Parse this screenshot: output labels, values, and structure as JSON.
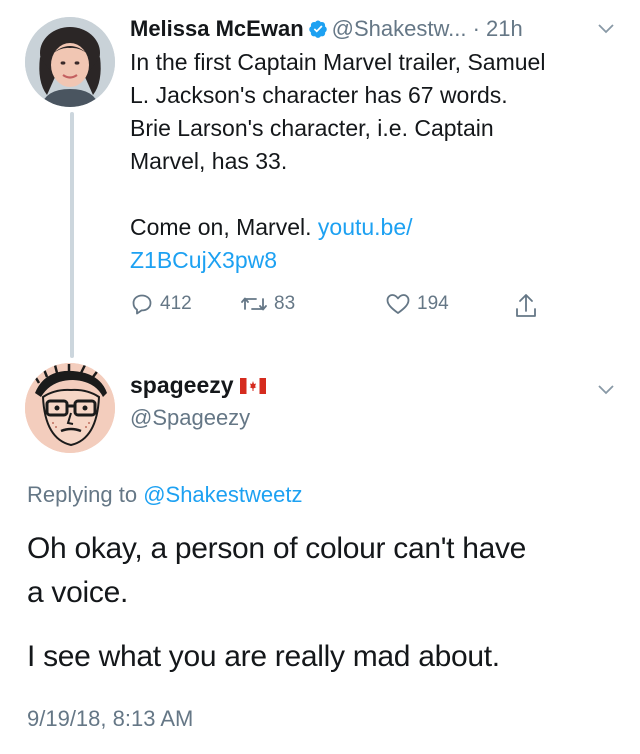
{
  "colors": {
    "link": "#1da1f2",
    "muted": "#657786",
    "text": "#14171a",
    "thread_line": "#ccd6dd"
  },
  "tweet1": {
    "author_name": "Melissa McEwan",
    "verified": true,
    "handle": "@Shakestw...",
    "separator": " · ",
    "time": "21h",
    "body_lines": [
      "In the first Captain Marvel trailer, Samuel",
      "L. Jackson's character has 67 words.",
      "Brie Larson's character, i.e. Captain",
      "Marvel, has 33."
    ],
    "body_line5_text": "Come on, Marvel. ",
    "link_line1": "youtu.be/",
    "link_line2": "Z1BCujX3pw8",
    "actions": {
      "reply_icon": "reply-icon",
      "replies": "412",
      "retweet_icon": "retweet-icon",
      "retweets": "83",
      "like_icon": "heart-icon",
      "likes": "194",
      "share_icon": "share-icon"
    }
  },
  "tweet2": {
    "author_name": "spageezy",
    "flag_icon": "canada-flag-icon",
    "handle": "@Spageezy",
    "replying_label": "Replying to ",
    "replying_handle": "@Shakestweetz",
    "body_para1_line1": "Oh okay, a person of colour can't have",
    "body_para1_line2": "a voice.",
    "body_para2": "I see what you are really mad about.",
    "timestamp": "9/19/18, 8:13 AM"
  }
}
